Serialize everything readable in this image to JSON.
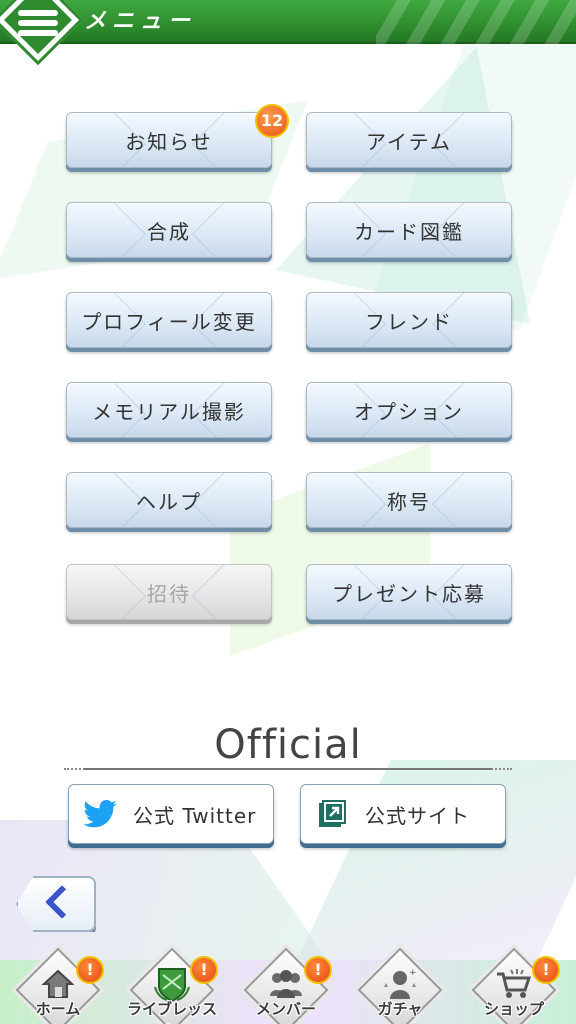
{
  "header": {
    "title": "メニュー",
    "menu_icon": "hamburger-menu-icon"
  },
  "menu": {
    "items": [
      {
        "label": "お知らせ",
        "badge": "12",
        "enabled": true
      },
      {
        "label": "アイテム",
        "enabled": true
      },
      {
        "label": "合成",
        "enabled": true
      },
      {
        "label": "カード図鑑",
        "enabled": true
      },
      {
        "label": "プロフィール変更",
        "enabled": true
      },
      {
        "label": "フレンド",
        "enabled": true
      },
      {
        "label": "メモリアル撮影",
        "enabled": true
      },
      {
        "label": "オプション",
        "enabled": true
      },
      {
        "label": "ヘルプ",
        "enabled": true
      },
      {
        "label": "称号",
        "enabled": true
      },
      {
        "label": "招待",
        "enabled": false
      },
      {
        "label": "プレゼント応募",
        "enabled": true
      }
    ]
  },
  "official": {
    "title": "Official",
    "twitter_label": "公式 Twitter",
    "site_label": "公式サイト"
  },
  "nav": {
    "items": [
      {
        "label": "ホーム",
        "icon": "home-icon",
        "alert": "!"
      },
      {
        "label": "ライブレッスン",
        "icon": "live-lesson-emblem-icon",
        "alert": "!"
      },
      {
        "label": "メンバー",
        "icon": "members-icon",
        "alert": "!"
      },
      {
        "label": "ガチャ",
        "icon": "gacha-icon"
      },
      {
        "label": "ショップ",
        "icon": "shop-cart-icon",
        "alert": "!"
      }
    ]
  },
  "colors": {
    "header_green": "#2e8d2e",
    "twitter_blue": "#1da1f2",
    "site_teal": "#1f6f60",
    "back_arrow_blue": "#3a55c8",
    "alert_orange": "#e8561a"
  }
}
